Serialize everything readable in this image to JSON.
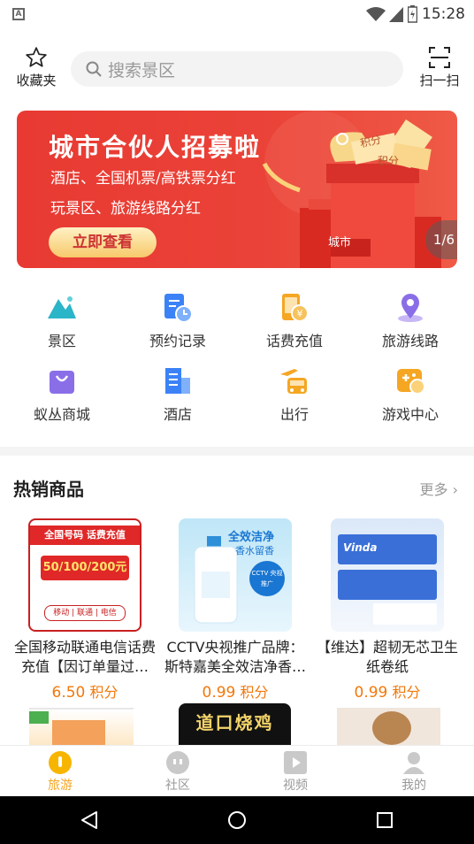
{
  "status": {
    "time": "15:28",
    "app_badge": "A"
  },
  "header": {
    "favorites_label": "收藏夹",
    "search_placeholder": "搜索景区",
    "scan_label": "扫一扫"
  },
  "banner": {
    "title": "城市合伙人招募啦",
    "line1": "酒店、全国机票/高铁票分红",
    "line2": "玩景区、旅游线路分红",
    "cta": "立即查看",
    "counter": "1/6",
    "deco_points": "积分",
    "deco_city": "城市"
  },
  "grid": [
    {
      "label": "景区",
      "icon": "mountain-icon",
      "color": "#2bb5c8"
    },
    {
      "label": "预约记录",
      "icon": "booking-record-icon",
      "color": "#3b82f6"
    },
    {
      "label": "话费充值",
      "icon": "phone-recharge-icon",
      "color": "#f5a623"
    },
    {
      "label": "旅游线路",
      "icon": "location-pin-icon",
      "color": "#8a6ee8"
    },
    {
      "label": "蚁丛商城",
      "icon": "shopping-bag-icon",
      "color": "#8a6ee8"
    },
    {
      "label": "酒店",
      "icon": "hotel-building-icon",
      "color": "#3b82f6"
    },
    {
      "label": "出行",
      "icon": "travel-bus-icon",
      "color": "#f5a623"
    },
    {
      "label": "游戏中心",
      "icon": "game-controller-icon",
      "color": "#f5a623"
    }
  ],
  "hot": {
    "title": "热销商品",
    "more": "更多",
    "products": [
      {
        "name": "全国移动联通电信话费充值【因订单量过…",
        "price": "6.50",
        "unit": "积分",
        "img_text1": "全国号码 话费充值",
        "img_text2": "50/100/200元",
        "img_text3": "移动 | 联通 | 电信"
      },
      {
        "name": "CCTV央视推广品牌：斯特嘉美全效洁净香…",
        "price": "0.99",
        "unit": "积分",
        "img_text1": "全效洁净",
        "img_text2": "香水留香",
        "img_text3": "CCTV 央视推广"
      },
      {
        "name": "【维达】超韧无芯卫生纸卷纸",
        "price": "0.99",
        "unit": "积分",
        "img_text1": "Vinda",
        "img_text2": "",
        "img_text3": ""
      }
    ],
    "row2_text": "道口烧鸡"
  },
  "tabs": [
    {
      "label": "旅游",
      "icon": "travel-tab-icon",
      "active": true
    },
    {
      "label": "社区",
      "icon": "community-tab-icon",
      "active": false
    },
    {
      "label": "视频",
      "icon": "video-tab-icon",
      "active": false
    },
    {
      "label": "我的",
      "icon": "profile-tab-icon",
      "active": false
    }
  ]
}
